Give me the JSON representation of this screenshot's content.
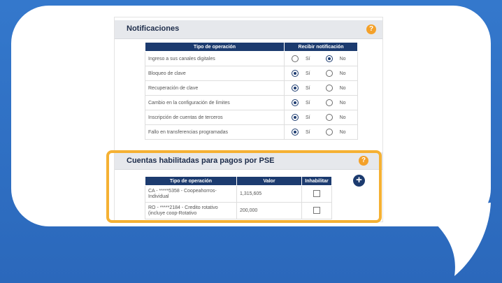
{
  "notificaciones": {
    "title": "Notificaciones",
    "col_operation": "Tipo de operación",
    "col_receive": "Recibir notificación",
    "yes_label": "Sí",
    "no_label": "No",
    "rows": [
      {
        "label": "Ingreso a sus canales digitales",
        "selected": "no"
      },
      {
        "label": "Bloqueo de clave",
        "selected": "si"
      },
      {
        "label": "Recuperación de clave",
        "selected": "si"
      },
      {
        "label": "Cambio en la configuración de límites",
        "selected": "si"
      },
      {
        "label": "Inscripción de cuentas de terceros",
        "selected": "si"
      },
      {
        "label": "Fallo en transferencias programadas",
        "selected": "si"
      }
    ]
  },
  "pse": {
    "title": "Cuentas habilitadas para pagos por PSE",
    "col_operation": "Tipo de operación",
    "col_value": "Valor",
    "col_disable": "Inhabilitar",
    "rows": [
      {
        "line1": "CA - *****5358 - Coopeahorros-",
        "line2": "Individual",
        "value": "1,315,605"
      },
      {
        "line1": "RO - *****2184 - Credito rotativo",
        "line2": "(incluye coop-Rotativo",
        "value": "200,000"
      }
    ]
  },
  "icons": {
    "help": "?",
    "add": "+"
  },
  "colors": {
    "header_navy": "#1c3b6f",
    "help_orange": "#f4a12a",
    "highlight": "#f5b133",
    "background_blue": "#2f6fc4"
  }
}
